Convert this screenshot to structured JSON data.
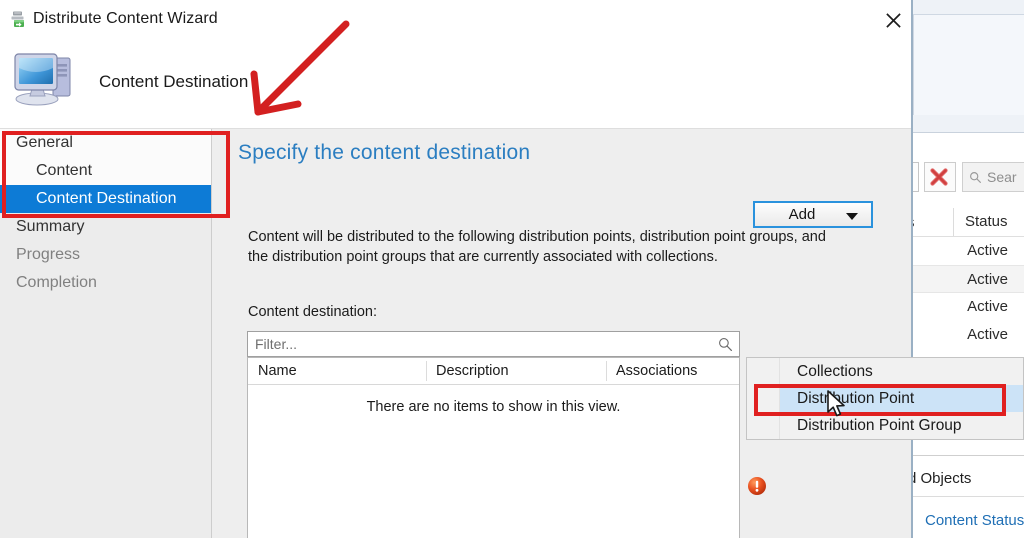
{
  "window": {
    "title": "Distribute Content Wizard",
    "title_icon": "distribute-content-icon",
    "close_label": "✕"
  },
  "header": {
    "title": "Content Destination",
    "icon": "computer-monitor-icon"
  },
  "sidebar": {
    "items": [
      {
        "label": "General",
        "indent": false,
        "state": "normal"
      },
      {
        "label": "Content",
        "indent": true,
        "state": "normal"
      },
      {
        "label": "Content Destination",
        "indent": true,
        "state": "selected"
      },
      {
        "label": "Summary",
        "indent": false,
        "state": "normal"
      },
      {
        "label": "Progress",
        "indent": false,
        "state": "dim"
      },
      {
        "label": "Completion",
        "indent": false,
        "state": "dim"
      }
    ]
  },
  "main": {
    "heading": "Specify the content destination",
    "description": "Content will be distributed to the following distribution points, distribution point groups, and the distribution point groups that are currently associated with collections.",
    "destination_label": "Content destination:",
    "filter": {
      "placeholder": "Filter...",
      "value": "",
      "icon": "search-icon"
    },
    "add_button": {
      "label": "Add",
      "chevron": "chevron-down-icon"
    },
    "grid": {
      "columns": [
        "Name",
        "Description",
        "Associations"
      ],
      "empty_message": "There are no items to show in this view.",
      "rows": []
    },
    "error_icon": "error-exclamation-icon"
  },
  "dropdown": {
    "items": [
      {
        "label": "Collections",
        "highlighted": false
      },
      {
        "label": "Distribution Point",
        "highlighted": true
      },
      {
        "label": "Distribution Point Group",
        "highlighted": false
      }
    ]
  },
  "background_window": {
    "delete_icon": "red-x-delete-icon",
    "search": {
      "placeholder": "Sear",
      "icon": "search-icon"
    },
    "table": {
      "partial_column": "s",
      "status_column": "Status",
      "status_values": [
        "Active",
        "Active",
        "Active",
        "Active"
      ]
    },
    "bottom_panel": {
      "objects_label": "d Objects",
      "content_status_link": "Content Status"
    }
  },
  "annotations": {
    "accent_color": "#e02020",
    "arrow": "down-left-arrow-annotation",
    "box_sidebar": "sidebar-highlight-box",
    "box_menu": "distribution-point-highlight-box"
  },
  "colors": {
    "selection_blue": "#0d7bd6",
    "heading_blue": "#2b7ec1",
    "link_blue": "#1f6fb5",
    "focus_blue": "#2a92dd",
    "menu_highlight": "#cce3f7",
    "annotation_red": "#e02020"
  }
}
